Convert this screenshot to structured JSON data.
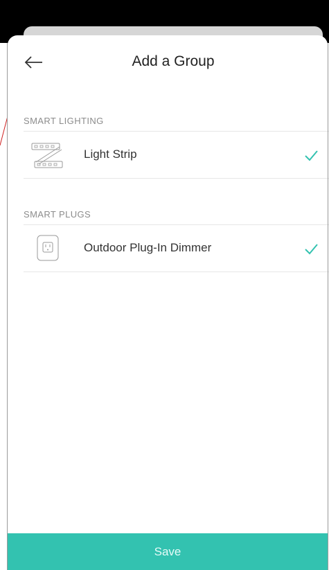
{
  "header": {
    "title": "Add a Group",
    "back_icon": "arrow-left-icon"
  },
  "sections": [
    {
      "label": "SMART LIGHTING",
      "items": [
        {
          "label": "Light Strip",
          "icon": "light-strip-icon",
          "selected": true
        }
      ]
    },
    {
      "label": "SMART PLUGS",
      "items": [
        {
          "label": "Outdoor Plug-In Dimmer",
          "icon": "outdoor-plug-icon",
          "selected": true
        }
      ]
    }
  ],
  "footer": {
    "save_label": "Save"
  },
  "colors": {
    "accent": "#33c2b0",
    "check": "#33c2b0",
    "section_label": "#8c8c8c",
    "divider": "#e6e6e6"
  }
}
